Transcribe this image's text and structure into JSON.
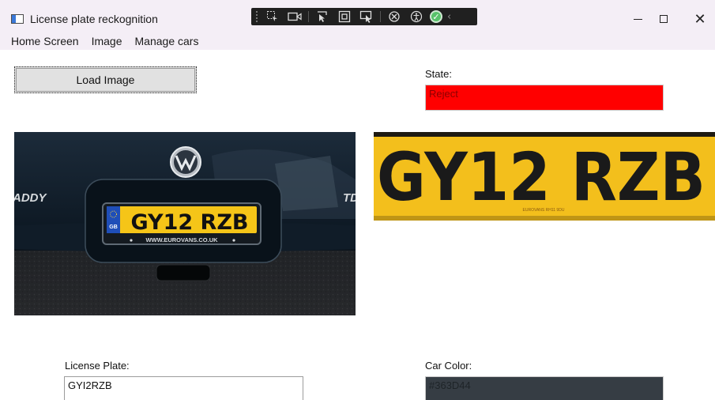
{
  "window": {
    "title": "License plate reckognition",
    "icon": "app-window-icon",
    "controls": {
      "minimize": "minimize-icon",
      "maximize": "maximize-icon",
      "close": "✕"
    }
  },
  "debug_toolbar": {
    "icons": [
      "select-element-icon",
      "record-icon",
      "pointer-icon",
      "frame-icon",
      "track-focus-icon",
      "hot-reload-icon",
      "accessibility-icon",
      "check-icon",
      "collapse-chevron-icon"
    ],
    "status_color": "#58c26a"
  },
  "menu": {
    "items": [
      "Home Screen",
      "Image",
      "Manage cars"
    ]
  },
  "actions": {
    "load_image": "Load Image"
  },
  "state": {
    "label": "State:",
    "value": "Reject",
    "color": "#ff0000"
  },
  "car_image": {
    "plate_text": "GY12 RZB",
    "dealer_text": "WWW.EUROVANS.CO.UK",
    "country_code": "GB",
    "badge_left": "ADDY",
    "badge_right": "TD",
    "plate_color": "#f5c518",
    "body_color": "#0e1a26"
  },
  "plate_crop": {
    "plate_text": "GY12 RZB",
    "small_text": "EUROVANS RH11 9DU",
    "background": "#f3bf1c"
  },
  "license_plate": {
    "label": "License Plate:",
    "value": "GYI2RZB"
  },
  "car_color": {
    "label": "Car Color:",
    "value": "#363D44",
    "swatch": "#363d44"
  }
}
